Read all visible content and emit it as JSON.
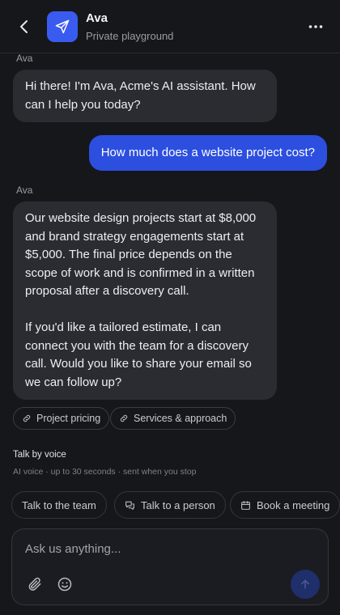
{
  "header": {
    "name": "Ava",
    "subtitle": "Private playground",
    "accent": "#3a5bf0"
  },
  "messages": [
    {
      "sender": "Ava",
      "role": "bot",
      "paragraphs": [
        "Hi there! I'm Ava, Acme's AI assistant. How can I help you today?"
      ]
    },
    {
      "role": "user",
      "text": "How much does a website project cost?"
    },
    {
      "sender": "Ava",
      "role": "bot",
      "paragraphs": [
        "Our website design projects start at $8,000 and brand strategy engagements start at $5,000. The final price depends on the scope of work and is confirmed in a written proposal after a discovery call.",
        "If you'd like a tailored estimate, I can connect you with the team for a discovery call. Would you like to share your email so we can follow up?"
      ]
    }
  ],
  "sources": [
    {
      "label": "Project pricing",
      "icon": "link-icon"
    },
    {
      "label": "Services & approach",
      "icon": "link-icon"
    }
  ],
  "voice": {
    "title": "Talk by voice",
    "subtitle": "AI voice · up to 30 seconds · sent when you stop"
  },
  "actions": [
    {
      "label": "Talk to the team",
      "icon": ""
    },
    {
      "label": "Talk to a person",
      "icon": "chat-bubbles-icon"
    },
    {
      "label": "Book a meeting",
      "icon": "calendar-icon"
    }
  ],
  "composer": {
    "placeholder": "Ask us anything..."
  },
  "colors": {
    "background": "#16171b",
    "user_bubble": "#2c4fe0",
    "bot_bubble": "#2a2c32"
  }
}
